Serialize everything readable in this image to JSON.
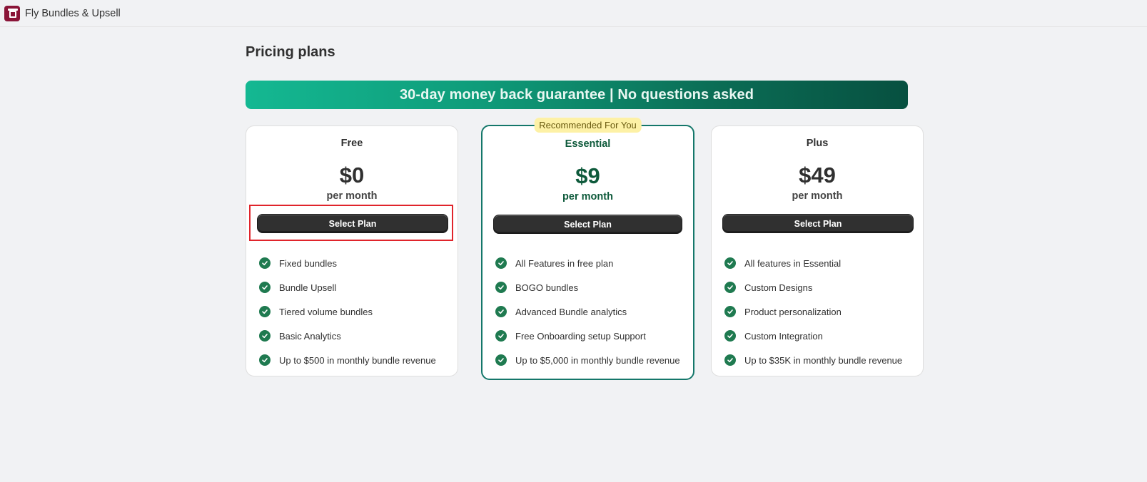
{
  "app": {
    "title": "Fly Bundles & Upsell"
  },
  "page": {
    "title": "Pricing plans"
  },
  "banner": {
    "text": "30-day money back guarantee | No questions asked"
  },
  "colors": {
    "accent": "#14776a",
    "banner_start": "#14b892",
    "banner_end": "#075040",
    "check": "#1f7a50",
    "badge": "#fdf1a6",
    "button": "#303030",
    "highlight": "#e0242b"
  },
  "plans": [
    {
      "name": "Free",
      "price": "$0",
      "period": "per month",
      "button": "Select Plan",
      "features": [
        "Fixed bundles",
        "Bundle Upsell",
        "Tiered volume bundles",
        "Basic Analytics",
        "Up to $500 in monthly bundle revenue"
      ]
    },
    {
      "name": "Essential",
      "price": "$9",
      "period": "per month",
      "button": "Select Plan",
      "badge": "Recommended For You",
      "features": [
        "All Features in free plan",
        "BOGO bundles",
        "Advanced Bundle analytics",
        "Free Onboarding setup Support",
        "Up to $5,000 in monthly bundle revenue"
      ]
    },
    {
      "name": "Plus",
      "price": "$49",
      "period": "per month",
      "button": "Select Plan",
      "features": [
        "All features in Essential",
        "Custom Designs",
        "Product personalization",
        "Custom Integration",
        "Up to $35K in monthly bundle revenue"
      ]
    }
  ]
}
